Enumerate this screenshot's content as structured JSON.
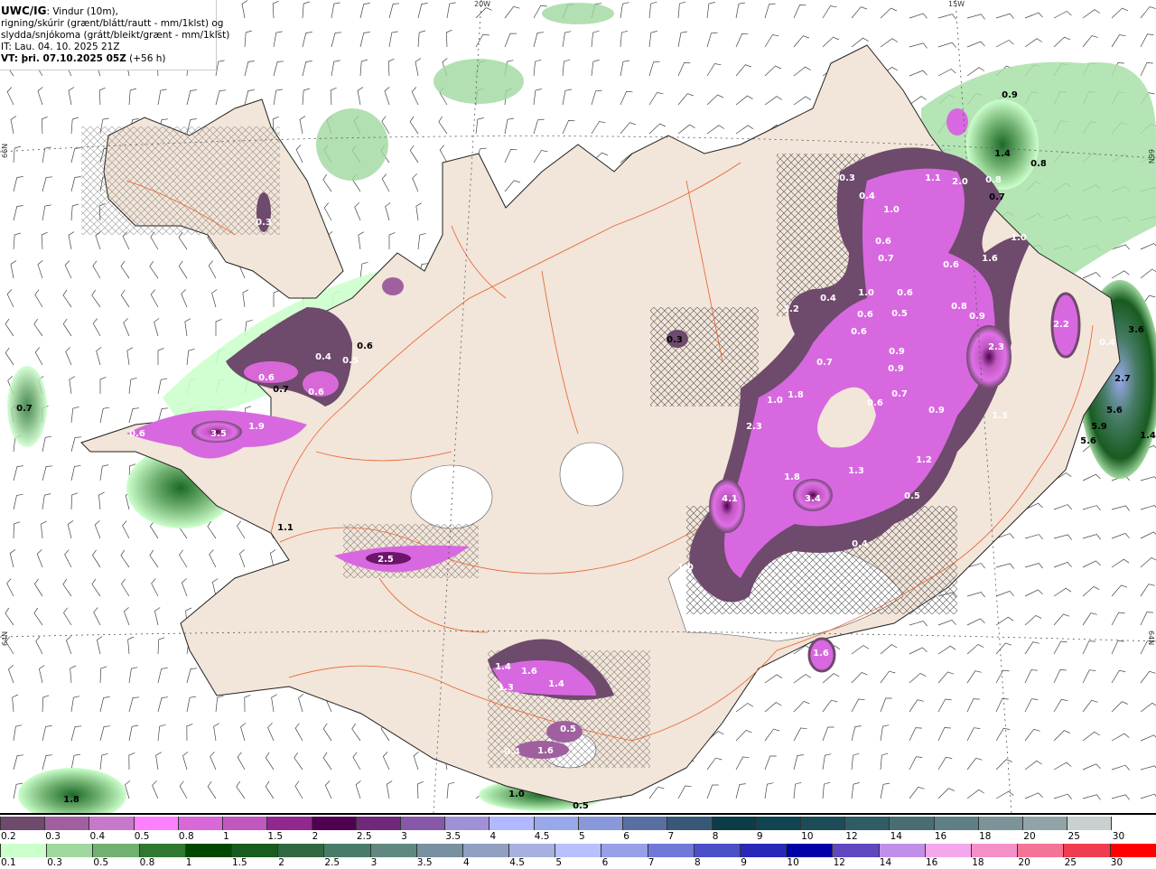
{
  "header": {
    "model": "UWC/IG",
    "line1": ": Vindur (10m),",
    "line2": "rigning/skúrir (grænt/blátt/rautt - mm/1klst) og",
    "line3": "slydda/snjókoma (grátt/bleikt/grænt - mm/1klst)",
    "init_time": "IT: Lau. 04. 10. 2025 21Z",
    "valid_time": "VT: þri. 07.10.2025 05Z",
    "lead": "(+56 h)"
  },
  "graticule": {
    "lon_20w": "20W",
    "lon_15w": "15W",
    "lat_66n": "66N",
    "lat_64n": "64N"
  },
  "map_colors": {
    "sea": "#ffffff",
    "land": "#f2e5d9",
    "glacier": "#ffffff",
    "roads": "#e8602c",
    "coast": "#222222"
  },
  "precip_labels": [
    "0.3",
    "0.6",
    "0.4",
    "0.5",
    "0.6",
    "3.5",
    "1.9",
    "0.6",
    "2.5",
    "1.4",
    "1.6",
    "1.3",
    "1.4",
    "0.5",
    "0.4",
    "1.6",
    "1.6",
    "0.3",
    "0.3",
    "0.4",
    "1.1",
    "2.0",
    "0.8",
    "1.0",
    "0.6",
    "0.7",
    "1.0",
    "1.6",
    "0.6",
    "0.4",
    "1.2",
    "1.0",
    "0.6",
    "0.6",
    "0.5",
    "0.8",
    "0.9",
    "0.6",
    "0.9",
    "0.9",
    "2.3",
    "0.7",
    "1.0",
    "1.8",
    "0.7",
    "0.6",
    "0.9",
    "2.3",
    "1.3",
    "1.2",
    "1.8",
    "1.3",
    "3.4",
    "4.1",
    "0.5",
    "0.4",
    "1.0",
    "2.2",
    "0.7",
    "0.7",
    "0.6",
    "1.1",
    "1.8",
    "1.0",
    "0.5",
    "0.9",
    "1.4",
    "0.8",
    "0.7",
    "3.6",
    "0.4",
    "2.7",
    "5.6",
    "5.9",
    "5.6",
    "1.4"
  ],
  "legend": {
    "snow_scale": {
      "labels": [
        "0.2",
        "0.3",
        "0.4",
        "0.5",
        "0.8",
        "1",
        "1.5",
        "2",
        "2.5",
        "3",
        "3.5",
        "4",
        "4.5",
        "5",
        "6",
        "7",
        "8",
        "9",
        "10",
        "12",
        "14",
        "16",
        "18",
        "20",
        "25",
        "30"
      ],
      "colors": [
        "#6e4a6c",
        "#a060a0",
        "#c878c8",
        "#ff80ff",
        "#d868d8",
        "#c058c0",
        "#902890",
        "#500050",
        "#702878",
        "#8858a8",
        "#a090d8",
        "#b0b8ff",
        "#98a8e8",
        "#8898d8",
        "#5870a0",
        "#385878",
        "#0c3c48",
        "#104450",
        "#1c4c58",
        "#305c64",
        "#486e74",
        "#5e8084",
        "#7c9498",
        "#90a4a8",
        "#c8d0d0",
        "#ffffff"
      ]
    },
    "rain_scale": {
      "labels": [
        "0.1",
        "0.3",
        "0.5",
        "0.8",
        "1",
        "1.5",
        "2",
        "2.5",
        "3",
        "3.5",
        "4",
        "4.5",
        "5",
        "6",
        "7",
        "8",
        "9",
        "10",
        "12",
        "14",
        "16",
        "18",
        "20",
        "25",
        "30"
      ],
      "colors": [
        "#ccffcc",
        "#a0d8a0",
        "#70b070",
        "#307830",
        "#004800",
        "#185c20",
        "#306840",
        "#487c68",
        "#608880",
        "#7890a0",
        "#90a0c0",
        "#a8b0e0",
        "#b8c0ff",
        "#98a0e8",
        "#7078d8",
        "#4c50c8",
        "#2828b8",
        "#0000a8",
        "#6048c0",
        "#c090e8",
        "#f4a8ec",
        "#f490c8",
        "#f47498",
        "#f03c50",
        "#ff0000"
      ]
    }
  }
}
